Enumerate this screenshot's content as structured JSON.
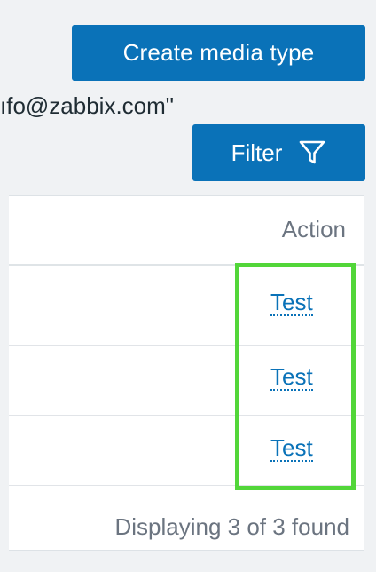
{
  "header": {
    "create_button_label": "Create media type",
    "filter_button_label": "Filter",
    "filter_icon": "funnel-icon"
  },
  "table": {
    "columns": {
      "action": "Action"
    },
    "rows": [
      {
        "value": "ıfo@zabbix.com\"",
        "action_label": "Test"
      },
      {
        "value": "",
        "action_label": "Test"
      },
      {
        "value": "",
        "action_label": "Test"
      }
    ],
    "footer": "Displaying 3 of 3 found"
  },
  "colors": {
    "button_bg": "#0a72b8",
    "link": "#0a72b8",
    "highlight": "#52d639"
  }
}
